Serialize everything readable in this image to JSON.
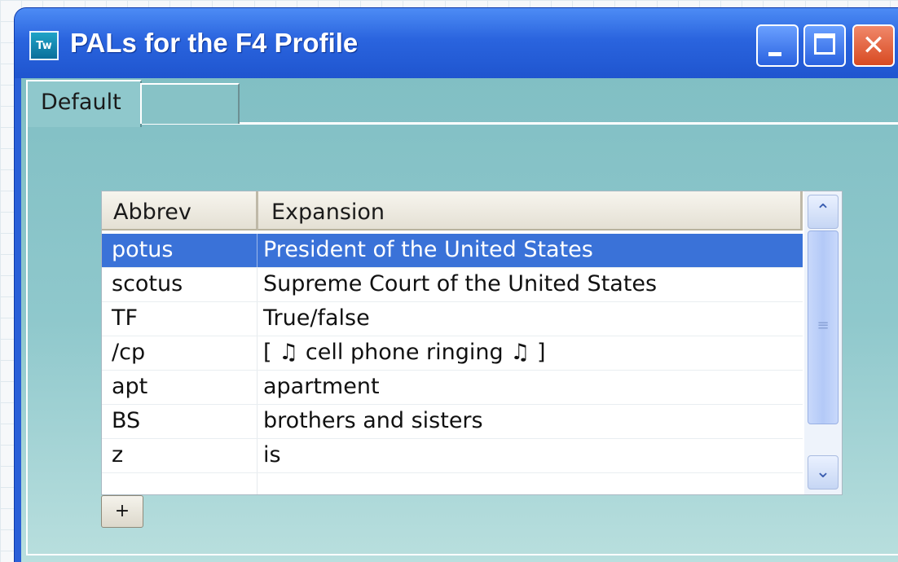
{
  "window": {
    "title": "PALs for the F4 Profile",
    "icon_label": "Tw",
    "close_glyph": "✕"
  },
  "tabs": [
    {
      "label": "Default"
    },
    {
      "label": ""
    }
  ],
  "table": {
    "columns": [
      "Abbrev",
      "Expansion"
    ],
    "rows": [
      {
        "abbrev": "potus",
        "expansion": "President of the United States",
        "selected": true
      },
      {
        "abbrev": "scotus",
        "expansion": "Supreme Court of the United States"
      },
      {
        "abbrev": "TF",
        "expansion": "True/false"
      },
      {
        "abbrev": "/cp",
        "expansion": "[ ♫ cell phone ringing ♫ ]"
      },
      {
        "abbrev": "apt",
        "expansion": "apartment"
      },
      {
        "abbrev": "BS",
        "expansion": "brothers and sisters"
      },
      {
        "abbrev": "z",
        "expansion": "is"
      }
    ]
  },
  "scrollbar": {
    "up_glyph": "⌃",
    "down_glyph": "⌄",
    "grip_glyph": "≡"
  },
  "add_button": {
    "label": "+"
  },
  "colors": {
    "selection": "#3a72d8",
    "titlebar": "#2a64de",
    "panel": "#8fc8cc"
  }
}
